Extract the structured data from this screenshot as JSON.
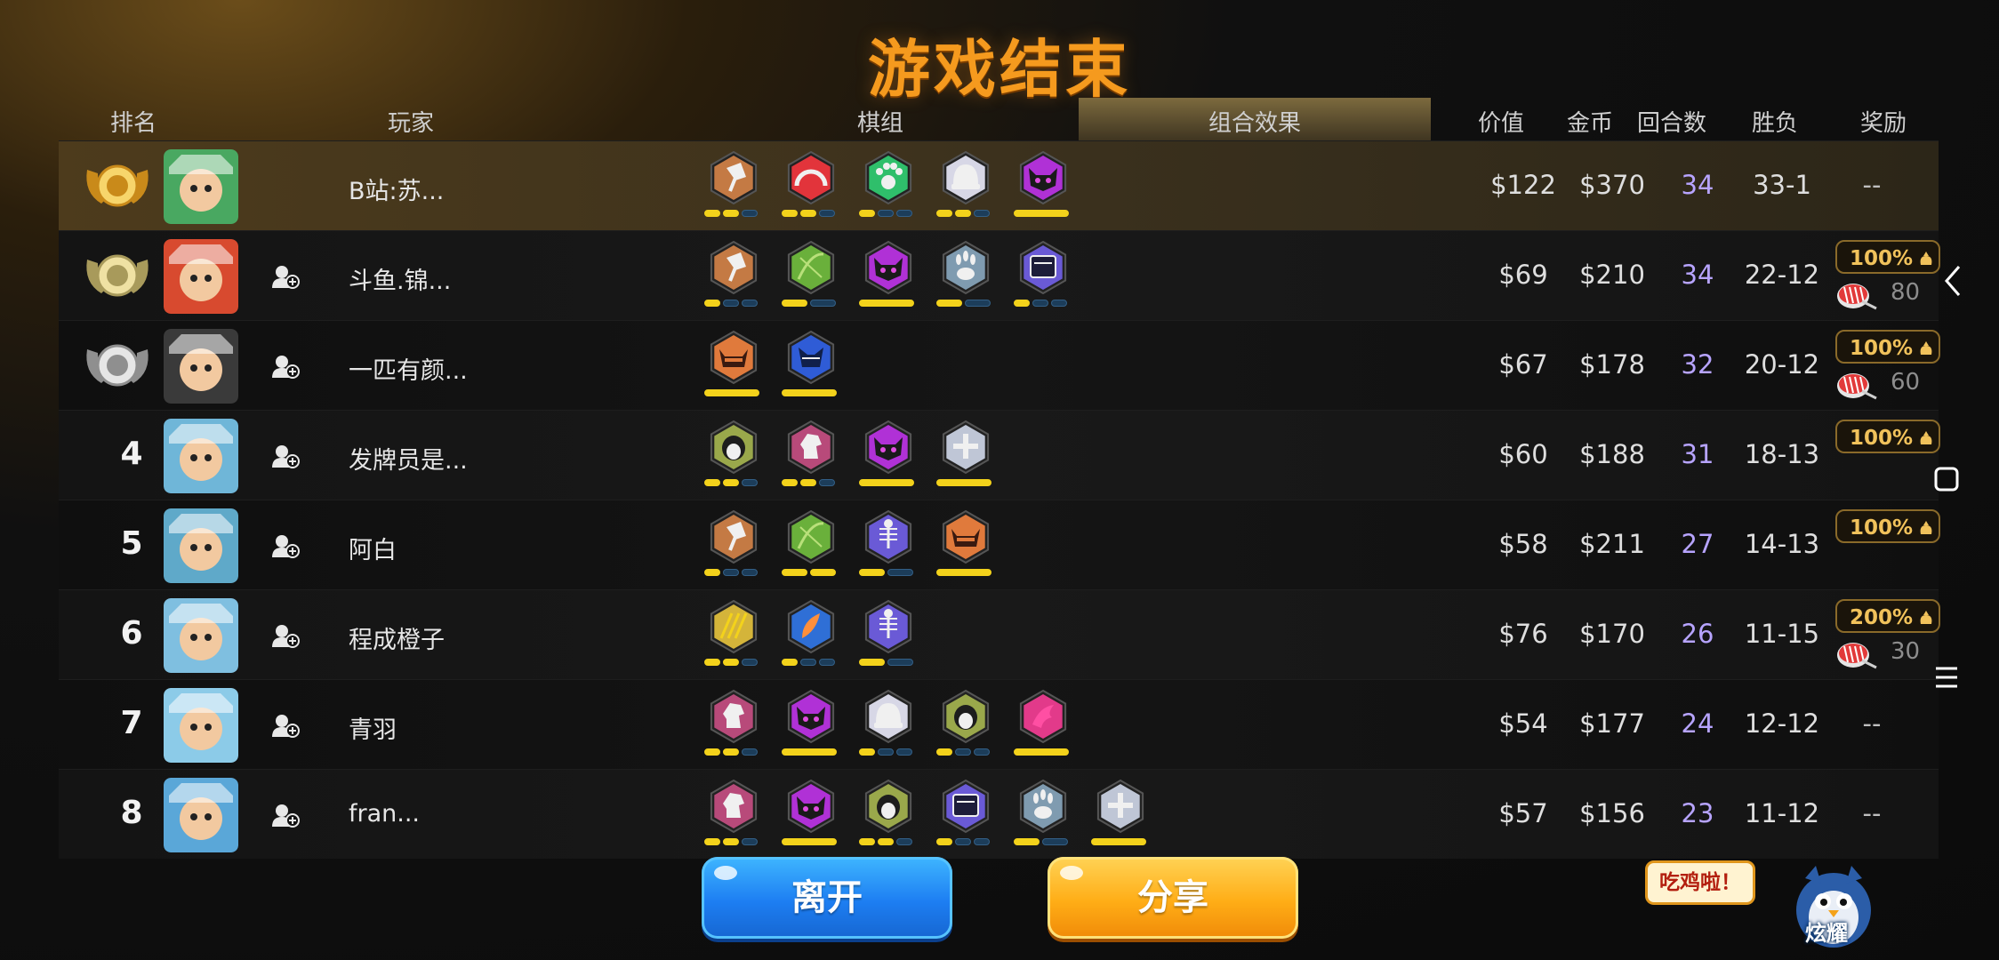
{
  "title": "游戏结束",
  "headers": {
    "rank": "排名",
    "player": "玩家",
    "lineup": "棋组",
    "synergy": "组合效果",
    "value": "价值",
    "coins": "金币",
    "rounds": "回合数",
    "winloss": "胜负",
    "reward": "奖励"
  },
  "rows": [
    {
      "rank": "",
      "medal": "gold",
      "avatar": "horse-portrait",
      "friend": false,
      "name": "B站:苏...",
      "value": "$122",
      "coins": "$370",
      "rounds": "34",
      "winloss": "33-1",
      "reward": "--",
      "bonus": "",
      "sushi": "",
      "traits": [
        {
          "icon": "axe-icon",
          "color": "#c47a44",
          "pips": [
            1,
            1,
            0
          ]
        },
        {
          "icon": "arch-icon",
          "color": "#e2343b",
          "pips": [
            1,
            1,
            0
          ]
        },
        {
          "icon": "paw-icon",
          "color": "#2fbf6b",
          "pips": [
            1,
            0,
            0
          ]
        },
        {
          "icon": "helmet-icon",
          "color": "#d7d7e6",
          "pips": [
            1,
            1,
            0
          ]
        },
        {
          "icon": "demon-icon",
          "color": "#b031d6",
          "pips": [
            1
          ]
        }
      ]
    },
    {
      "rank": "",
      "medal": "silver-gold",
      "avatar": "monkey-king-portrait",
      "friend": true,
      "name": "斗鱼.锦...",
      "value": "$69",
      "coins": "$210",
      "rounds": "34",
      "winloss": "22-12",
      "reward": "",
      "bonus": "100%",
      "sushi": "80",
      "traits": [
        {
          "icon": "axe-icon",
          "color": "#c47a44",
          "pips": [
            1,
            0,
            0
          ]
        },
        {
          "icon": "bow-icon",
          "color": "#6ab03b",
          "pips": [
            1,
            0
          ]
        },
        {
          "icon": "demon-icon",
          "color": "#b031d6",
          "pips": [
            1
          ]
        },
        {
          "icon": "claw-icon",
          "color": "#7f9bb0",
          "pips": [
            1,
            0
          ]
        },
        {
          "icon": "book-icon",
          "color": "#6a5ad6",
          "pips": [
            1,
            0,
            0
          ]
        }
      ]
    },
    {
      "rank": "",
      "medal": "silver",
      "avatar": "bandit-portrait",
      "friend": true,
      "name": "一匹有颜...",
      "value": "$67",
      "coins": "$178",
      "rounds": "32",
      "winloss": "20-12",
      "reward": "",
      "bonus": "100%",
      "sushi": "60",
      "traits": [
        {
          "icon": "horned-helm-icon",
          "color": "#e07a3c",
          "pips": [
            1
          ]
        },
        {
          "icon": "wolf-icon",
          "color": "#2f5cd6",
          "pips": [
            1
          ]
        }
      ]
    },
    {
      "rank": "4",
      "medal": "",
      "avatar": "elf-portrait",
      "friend": true,
      "name": "发牌员是...",
      "value": "$60",
      "coins": "$188",
      "rounds": "31",
      "winloss": "18-13",
      "reward": "",
      "bonus": "100%",
      "sushi": "",
      "traits": [
        {
          "icon": "penguin-icon",
          "color": "#9aa84b",
          "pips": [
            1,
            1,
            0
          ]
        },
        {
          "icon": "knight-icon",
          "color": "#b84a7a",
          "pips": [
            1,
            1,
            0
          ]
        },
        {
          "icon": "demon-icon",
          "color": "#b031d6",
          "pips": [
            1
          ]
        },
        {
          "icon": "cross-icon",
          "color": "#bfc6d6",
          "pips": [
            1
          ]
        }
      ]
    },
    {
      "rank": "5",
      "medal": "",
      "avatar": "goggles-portrait",
      "friend": true,
      "name": "阿白",
      "value": "$58",
      "coins": "$211",
      "rounds": "27",
      "winloss": "14-13",
      "reward": "",
      "bonus": "100%",
      "sushi": "",
      "traits": [
        {
          "icon": "axe-icon",
          "color": "#c47a44",
          "pips": [
            1,
            0,
            0
          ]
        },
        {
          "icon": "bow-icon",
          "color": "#6ab03b",
          "pips": [
            1,
            1
          ]
        },
        {
          "icon": "fishbone-icon",
          "color": "#6a5ad6",
          "pips": [
            1,
            0
          ]
        },
        {
          "icon": "horned-helm-icon",
          "color": "#e07a3c",
          "pips": [
            1
          ]
        }
      ]
    },
    {
      "rank": "6",
      "medal": "",
      "avatar": "panda-portrait",
      "friend": true,
      "name": "程成橙子",
      "value": "$76",
      "coins": "$170",
      "rounds": "26",
      "winloss": "11-15",
      "reward": "",
      "bonus": "200%",
      "sushi": "30",
      "traits": [
        {
          "icon": "trident-icon",
          "color": "#d4b43a",
          "pips": [
            1,
            1,
            0
          ]
        },
        {
          "icon": "feather-icon",
          "color": "#2f6fd6",
          "pips": [
            1,
            0,
            0
          ]
        },
        {
          "icon": "fishbone-icon",
          "color": "#6a5ad6",
          "pips": [
            1,
            0
          ]
        }
      ]
    },
    {
      "rank": "7",
      "medal": "",
      "avatar": "masked-portrait",
      "friend": true,
      "name": "青羽",
      "value": "$54",
      "coins": "$177",
      "rounds": "24",
      "winloss": "12-12",
      "reward": "--",
      "bonus": "",
      "sushi": "",
      "traits": [
        {
          "icon": "knight-icon",
          "color": "#b84a7a",
          "pips": [
            1,
            1,
            0
          ]
        },
        {
          "icon": "demon-icon",
          "color": "#b031d6",
          "pips": [
            1
          ]
        },
        {
          "icon": "helmet-icon",
          "color": "#d7d7e6",
          "pips": [
            1,
            0,
            0
          ]
        },
        {
          "icon": "penguin-icon",
          "color": "#9aa84b",
          "pips": [
            1,
            0,
            0
          ]
        },
        {
          "icon": "dragon-icon",
          "color": "#e23a8a",
          "pips": [
            1
          ]
        }
      ]
    },
    {
      "rank": "8",
      "medal": "",
      "avatar": "blue-hair-portrait",
      "friend": true,
      "name": "fran...",
      "value": "$57",
      "coins": "$156",
      "rounds": "23",
      "winloss": "11-12",
      "reward": "--",
      "bonus": "",
      "sushi": "",
      "traits": [
        {
          "icon": "knight-icon",
          "color": "#b84a7a",
          "pips": [
            1,
            1,
            0
          ]
        },
        {
          "icon": "demon-icon",
          "color": "#b031d6",
          "pips": [
            1
          ]
        },
        {
          "icon": "penguin-icon",
          "color": "#9aa84b",
          "pips": [
            1,
            1,
            0
          ]
        },
        {
          "icon": "book-icon",
          "color": "#6a5ad6",
          "pips": [
            1,
            0,
            0
          ]
        },
        {
          "icon": "claw-icon",
          "color": "#7f9bb0",
          "pips": [
            1,
            0
          ]
        },
        {
          "icon": "cross-icon",
          "color": "#bfc6d6",
          "pips": [
            1
          ]
        }
      ]
    }
  ],
  "buttons": {
    "leave": "离开",
    "share": "分享"
  },
  "share_bubble": "吃鸡啦！",
  "mascot_label": "炫耀"
}
